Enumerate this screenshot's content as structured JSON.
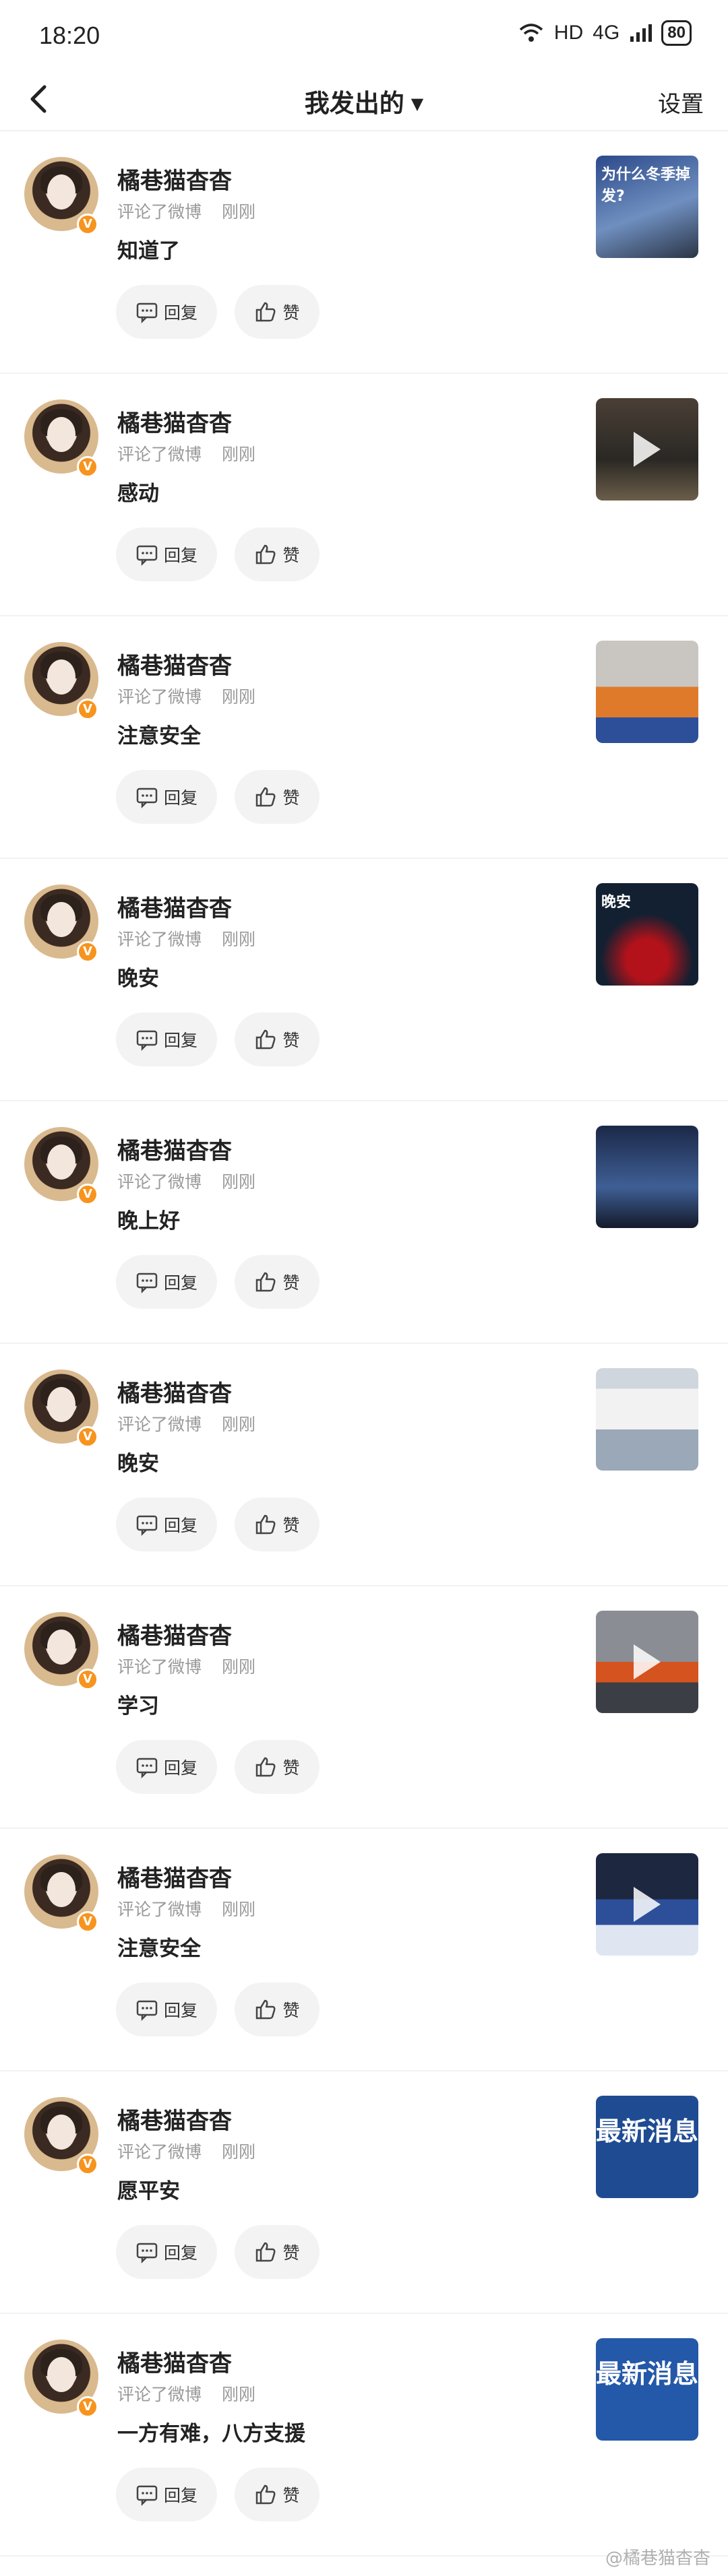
{
  "status_bar": {
    "time": "18:20",
    "network": "HD",
    "signal": "4G",
    "battery": "80"
  },
  "nav": {
    "title": "我发出的",
    "settings": "设置"
  },
  "items": [
    {
      "name": "橘巷猫杳杳",
      "action": "评论了微博",
      "time": "刚刚",
      "content": "知道了",
      "reply": "回复",
      "like": "赞",
      "thumb_text": "为什么冬季掉发?"
    },
    {
      "name": "橘巷猫杳杳",
      "action": "评论了微博",
      "time": "刚刚",
      "content": "感动",
      "reply": "回复",
      "like": "赞",
      "thumb_text": ""
    },
    {
      "name": "橘巷猫杳杳",
      "action": "评论了微博",
      "time": "刚刚",
      "content": "注意安全",
      "reply": "回复",
      "like": "赞",
      "thumb_text": ""
    },
    {
      "name": "橘巷猫杳杳",
      "action": "评论了微博",
      "time": "刚刚",
      "content": "晚安",
      "reply": "回复",
      "like": "赞",
      "thumb_text": "晚安"
    },
    {
      "name": "橘巷猫杳杳",
      "action": "评论了微博",
      "time": "刚刚",
      "content": "晚上好",
      "reply": "回复",
      "like": "赞",
      "thumb_text": ""
    },
    {
      "name": "橘巷猫杳杳",
      "action": "评论了微博",
      "time": "刚刚",
      "content": "晚安",
      "reply": "回复",
      "like": "赞",
      "thumb_text": ""
    },
    {
      "name": "橘巷猫杳杳",
      "action": "评论了微博",
      "time": "刚刚",
      "content": "学习",
      "reply": "回复",
      "like": "赞",
      "thumb_text": ""
    },
    {
      "name": "橘巷猫杳杳",
      "action": "评论了微博",
      "time": "刚刚",
      "content": "注意安全",
      "reply": "回复",
      "like": "赞",
      "thumb_text": ""
    },
    {
      "name": "橘巷猫杳杳",
      "action": "评论了微博",
      "time": "刚刚",
      "content": "愿平安",
      "reply": "回复",
      "like": "赞",
      "thumb_text": "最新消息"
    },
    {
      "name": "橘巷猫杳杳",
      "action": "评论了微博",
      "time": "刚刚",
      "content": "一方有难，八方支援",
      "reply": "回复",
      "like": "赞",
      "thumb_text": "最新消息"
    }
  ],
  "watermark": "@橘巷猫杳杳",
  "colors": {
    "verified_badge": "#f7941d",
    "button_bg": "#f3f3f3",
    "meta_text": "#9a9a9a"
  }
}
